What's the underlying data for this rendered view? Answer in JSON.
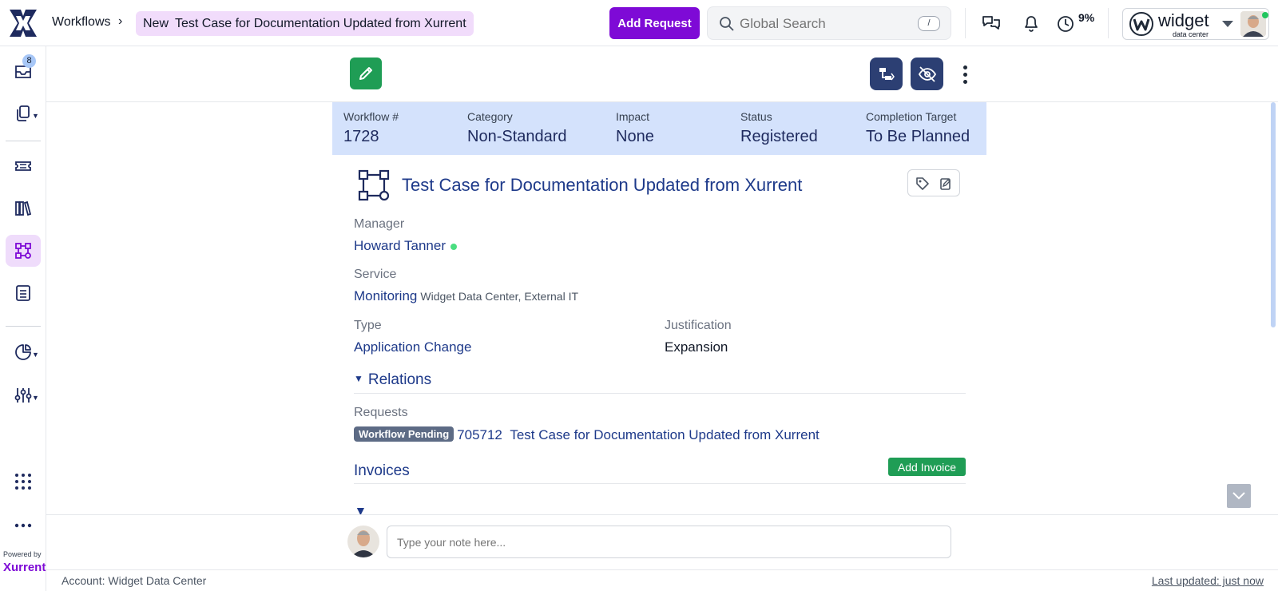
{
  "header": {
    "breadcrumb_root": "Workflows",
    "breadcrumb_state": "New",
    "breadcrumb_current": "Test Case for Documentation Updated from Xurrent",
    "add_request_label": "Add Request",
    "search_placeholder": "Global Search",
    "search_shortcut": "/",
    "progress_percent": "9%",
    "account_brand": "widget",
    "account_brand_sub": "data center",
    "accent_color": "#7e0ad6"
  },
  "sidebar": {
    "inbox_badge": "8",
    "powered_by": "Powered by",
    "powered_brand": "Xurrent",
    "items": [
      "inbox-icon",
      "copy-icon",
      "ticket-icon",
      "library-icon",
      "workflow-icon",
      "list-icon",
      "pie-chart-icon",
      "sliders-icon",
      "apps-grid-icon",
      "more-icon"
    ]
  },
  "summary": {
    "workflow_label": "Workflow #",
    "workflow_value": "1728",
    "category_label": "Category",
    "category_value": "Non-Standard",
    "impact_label": "Impact",
    "impact_value": "None",
    "status_label": "Status",
    "status_value": "Registered",
    "completion_label": "Completion Target",
    "completion_value": "To Be Planned"
  },
  "record": {
    "title": "Test Case for Documentation Updated from Xurrent",
    "manager_label": "Manager",
    "manager_value": "Howard Tanner",
    "service_label": "Service",
    "service_value": "Monitoring",
    "service_sub": "Widget Data Center, External IT",
    "type_label": "Type",
    "type_value": "Application Change",
    "justification_label": "Justification",
    "justification_value": "Expansion"
  },
  "relations": {
    "heading": "Relations",
    "requests_label": "Requests",
    "request_status": "Workflow Pending",
    "request_id": "705712",
    "request_subject": "Test Case for Documentation Updated from Xurrent"
  },
  "invoices": {
    "heading": "Invoices",
    "add_label": "Add Invoice"
  },
  "notes": {
    "placeholder": "Type your note here..."
  },
  "footer": {
    "account": "Account: Widget Data Center",
    "last_updated": "Last updated: just now"
  }
}
